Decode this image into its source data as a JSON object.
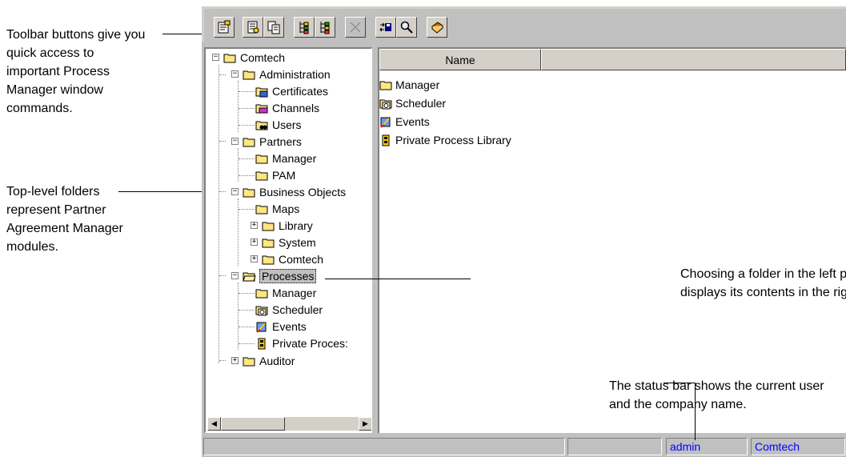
{
  "callouts": {
    "toolbar": [
      "Toolbar buttons give you",
      "quick access to",
      "important Process",
      "Manager window",
      "commands."
    ],
    "folders": [
      "Top-level folders",
      "represent Partner",
      "Agreement Manager",
      "modules."
    ],
    "choosing": [
      "Choosing a folder in the left panel",
      "displays its contents in the right panel."
    ],
    "status": [
      "The status bar shows the current user",
      "and the company name."
    ]
  },
  "toolbar": {
    "buttons": [
      {
        "name": "new-icon",
        "enabled": true
      },
      {
        "name": "properties-icon",
        "enabled": true
      },
      {
        "name": "copy-icon",
        "enabled": true
      },
      {
        "name": "expand-icon",
        "enabled": true
      },
      {
        "name": "collapse-icon",
        "enabled": true
      },
      {
        "name": "delete-icon",
        "enabled": false
      },
      {
        "name": "import-icon",
        "enabled": true
      },
      {
        "name": "find-icon",
        "enabled": true
      },
      {
        "name": "help-book-icon",
        "enabled": true
      }
    ]
  },
  "tree": {
    "root": "Comtech",
    "administration": "Administration",
    "certificates": "Certificates",
    "channels": "Channels",
    "users": "Users",
    "partners": "Partners",
    "partners_manager": "Manager",
    "pam": "PAM",
    "business_objects": "Business Objects",
    "maps": "Maps",
    "library": "Library",
    "system": "System",
    "bo_comtech": "Comtech",
    "processes": "Processes",
    "proc_manager": "Manager",
    "scheduler": "Scheduler",
    "events": "Events",
    "private_process": "Private Proces:",
    "auditor": "Auditor"
  },
  "list": {
    "column_name": "Name",
    "items": [
      "Manager",
      "Scheduler",
      "Events",
      "Private Process Library"
    ]
  },
  "status": {
    "user": "admin",
    "company": "Comtech"
  },
  "colors": {
    "folder": "#ffe680",
    "status_text": "#0000ff"
  }
}
